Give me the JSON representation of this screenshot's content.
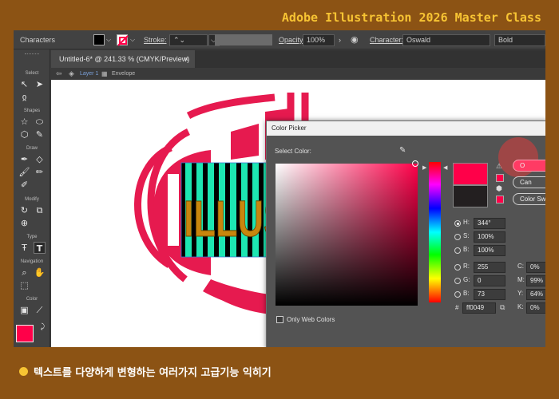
{
  "banner": "Adobe Illustration 2026 Master Class",
  "caption": "텍스트를 다양하게 변형하는 여러가지 고급기능 익히기",
  "colors": {
    "accent": "#f7c433",
    "brand_bg": "#8c5314",
    "selected": "#ff0049"
  },
  "control_bar": {
    "panel_label": "Characters",
    "stroke_label": "Stroke:",
    "opacity_label": "Opacity:",
    "opacity_value": "100%",
    "character_label": "Character:",
    "font_value": "Oswald",
    "style_value": "Bold"
  },
  "document": {
    "tab_title": "Untitled-6* @ 241.33 % (CMYK/Preview)",
    "close": "×",
    "breadcrumb_layer": "Layer 1",
    "breadcrumb_object": "Envelope",
    "artwork_text": "ILLUS"
  },
  "tools": {
    "sections": [
      "Select",
      "Shapes",
      "Draw",
      "Modify",
      "Type",
      "Navigation",
      "Color"
    ]
  },
  "color_picker": {
    "title": "Color Picker",
    "select_label": "Select Color:",
    "only_web_colors": "Only Web Colors",
    "buttons": {
      "ok": "O",
      "cancel": "Can",
      "swatches": "Color Sw"
    },
    "h_label": "H:",
    "h_value": "344°",
    "s_label": "S:",
    "s_value": "100%",
    "b_label": "B:",
    "b_value": "100%",
    "r_label": "R:",
    "r_value": "255",
    "g_label": "G:",
    "g_value": "0",
    "b2_label": "B:",
    "b2_value": "73",
    "hex_label": "#",
    "hex_value": "ff0049",
    "c_label": "C:",
    "c_value": "0%",
    "m_label": "M:",
    "m_value": "99%",
    "y_label": "Y:",
    "y_value": "64%",
    "k_label": "K:",
    "k_value": "0%"
  }
}
